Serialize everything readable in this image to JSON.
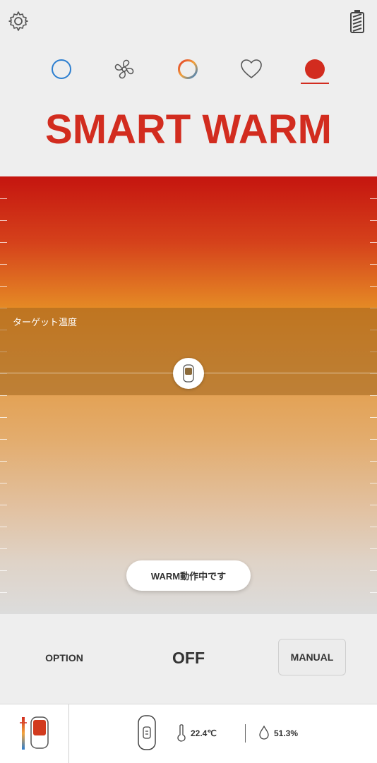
{
  "header": {
    "settings_icon": "gear-icon",
    "battery_icon": "battery-icon"
  },
  "modes": [
    {
      "id": "cool",
      "icon": "circle-outline-icon",
      "color": "#2d7fd0",
      "selected": false
    },
    {
      "id": "fan",
      "icon": "fan-icon",
      "color": "#555555",
      "selected": false
    },
    {
      "id": "auto",
      "icon": "gradient-ring-icon",
      "color": "#e07a2a",
      "selected": false
    },
    {
      "id": "favorite",
      "icon": "heart-icon",
      "color": "#555555",
      "selected": false
    },
    {
      "id": "warm",
      "icon": "filled-circle-icon",
      "color": "#d22c1f",
      "selected": true
    }
  ],
  "title": "SMART WARM",
  "panel": {
    "target_label": "ターゲット温度",
    "status_text": "WARM動作中です"
  },
  "controls": {
    "option_label": "OPTION",
    "power_state": "OFF",
    "manual_label": "MANUAL"
  },
  "footer": {
    "temperature": "22.4℃",
    "humidity": "51.3%"
  },
  "colors": {
    "accent": "#d22c1f",
    "background": "#eeeeee"
  }
}
